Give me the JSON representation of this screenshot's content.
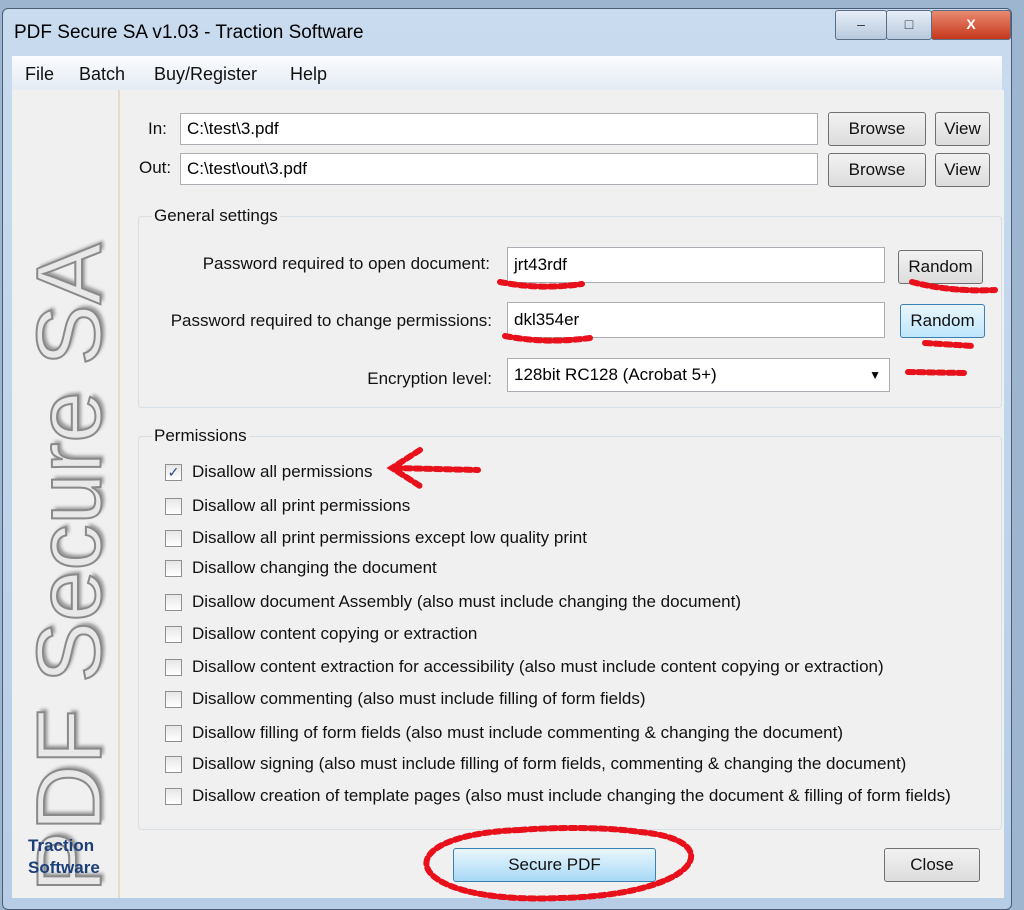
{
  "window": {
    "title": "PDF Secure SA v1.03 - Traction Software",
    "minimize": "–",
    "maximize": "□",
    "close": "X"
  },
  "menu": [
    "File",
    "Batch",
    "Buy/Register",
    "Help"
  ],
  "sidebar": {
    "logo_text": "PDF Secure SA",
    "brand_line1": "Traction",
    "brand_line2": "Software"
  },
  "files": {
    "in_label": "In:",
    "in_value": "C:\\test\\3.pdf",
    "out_label": "Out:",
    "out_value": "C:\\test\\out\\3.pdf",
    "browse": "Browse",
    "view": "View"
  },
  "general": {
    "legend": "General settings",
    "open_label": "Password required to open document:",
    "open_value": "jrt43rdf",
    "perm_label": "Password required to change permissions:",
    "perm_value": "dkl354er",
    "random": "Random",
    "enc_label": "Encryption level:",
    "enc_value": "128bit RC128 (Acrobat 5+)"
  },
  "permissions": {
    "legend": "Permissions",
    "items": [
      {
        "label": "Disallow all permissions",
        "checked": true
      },
      {
        "label": "Disallow all print permissions",
        "checked": false
      },
      {
        "label": "Disallow all print permissions except low quality print",
        "checked": false
      },
      {
        "label": "Disallow changing the document",
        "checked": false
      },
      {
        "label": "Disallow document Assembly (also must include changing the document)",
        "checked": false
      },
      {
        "label": "Disallow content copying or extraction",
        "checked": false
      },
      {
        "label": "Disallow content extraction for accessibility (also must include content copying or extraction)",
        "checked": false
      },
      {
        "label": "Disallow commenting (also must include filling of form fields)",
        "checked": false
      },
      {
        "label": "Disallow filling of form fields (also must include commenting & changing the document)",
        "checked": false
      },
      {
        "label": "Disallow signing  (also must include filling of form fields, commenting & changing the document)",
        "checked": false
      },
      {
        "label": "Disallow creation of template pages (also must include changing the document & filling of form fields)",
        "checked": false
      }
    ]
  },
  "actions": {
    "secure": "Secure PDF",
    "close": "Close"
  },
  "annotation_color": "#e8101a"
}
